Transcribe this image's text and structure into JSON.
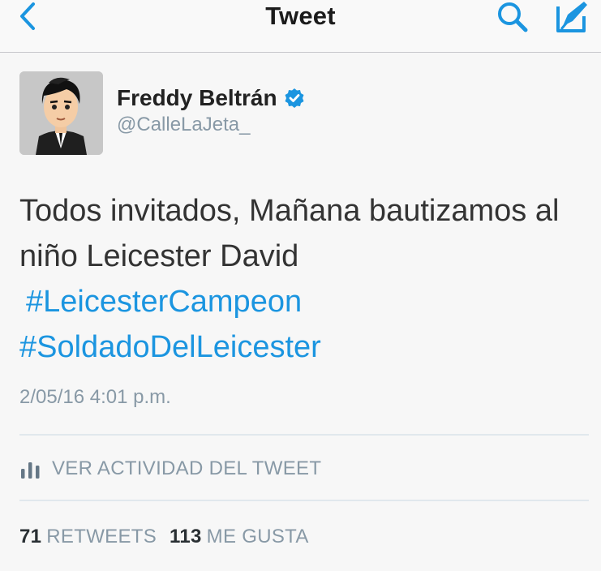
{
  "navbar": {
    "title": "Tweet",
    "back_icon": "chevron-left-icon",
    "search_icon": "search-icon",
    "compose_icon": "compose-icon",
    "accent_color": "#1b95e0"
  },
  "tweet": {
    "author": {
      "display_name": "Freddy Beltrán",
      "handle": "@CalleLaJeta_",
      "verified": true
    },
    "text_line1": "Todos invitados, Mañana bautizamos al",
    "text_line2": "niño Leicester David",
    "hashtags": [
      "#LeicesterCampeon",
      "#SoldadoDelLeicester"
    ],
    "timestamp": "2/05/16 4:01 p.m."
  },
  "activity": {
    "label": "VER ACTIVIDAD DEL TWEET",
    "icon": "bar-chart-icon"
  },
  "stats": {
    "retweets_count": "71",
    "retweets_label": "RETWEETS",
    "likes_count": "113",
    "likes_label": "ME GUSTA"
  }
}
